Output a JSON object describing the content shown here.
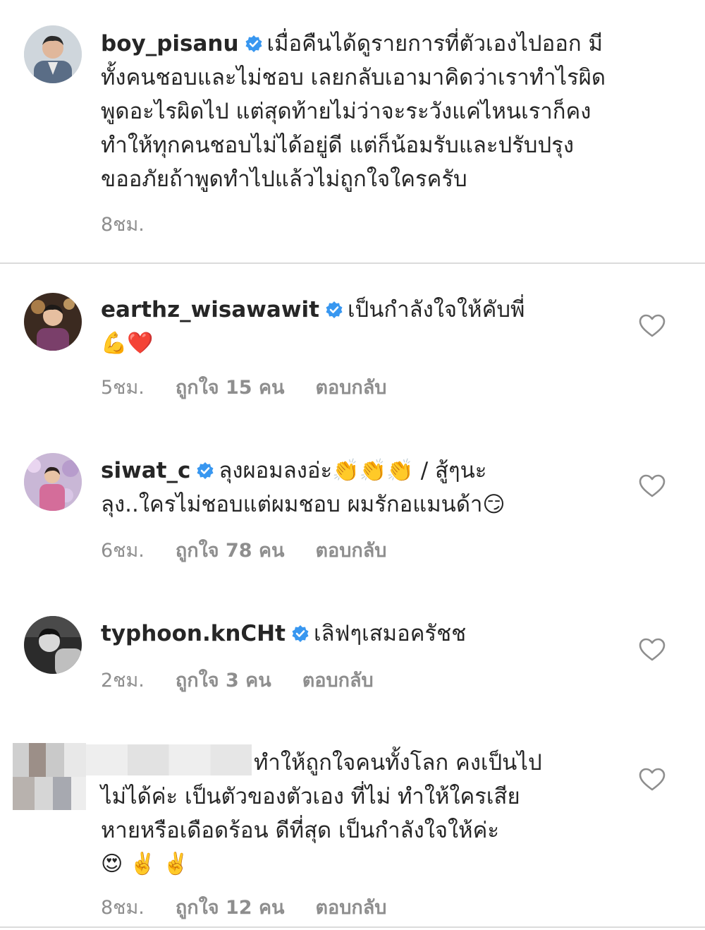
{
  "post": {
    "username": "boy_pisanu",
    "text_lines": [
      "เมื่อคืนได้ดูรายการที่ตัวเองไปออก มี",
      "ทั้งคนชอบและไม่ชอบ เลยกลับเอามาคิดว่าเราทำไรผิด",
      "พูดอะไรผิดไป แต่สุดท้ายไม่ว่าจะระวังแค่ไหนเราก็คง",
      "ทำให้ทุกคนชอบไม่ได้อยู่ดี แต่ก็น้อมรับและปรับปรุง",
      "ขออภัยถ้าพูดทำไปแล้วไม่ถูกใจใครครับ"
    ],
    "time": "8ชม."
  },
  "comments": [
    {
      "username": "earthz_wisawawit",
      "line1": "เป็นกำลังใจให้คับพี่",
      "line2": "💪❤️",
      "time": "5ชม.",
      "likes": "ถูกใจ 15 คน",
      "reply": "ตอบกลับ"
    },
    {
      "username": "siwat_c",
      "line1": "ลุงผอมลงอ่ะ👏👏👏 / สู้ๆนะ",
      "line2": "ลุง..ใครไม่ชอบแต่ผมชอบ ผมรักอแมนด้า😏",
      "time": "6ชม.",
      "likes": "ถูกใจ 78 คน",
      "reply": "ตอบกลับ"
    },
    {
      "username": "typhoon.knCHt",
      "line1": "เลิฟๆเสมอครัชช",
      "time": "2ชม.",
      "likes": "ถูกใจ 3 คน",
      "reply": "ตอบกลับ"
    },
    {
      "line1": "ทำให้ถูกใจคนทั้งโลก คงเป็นไป",
      "line2": "ไม่ได้ค่ะ เป็นตัวของตัวเอง ที่ไม่ ทำให้ใครเสีย",
      "line3": "หายหรือเดือดร้อน ดีที่สุด เป็นกำลังใจให้ค่ะ",
      "line4": "😍 ✌️ ✌️",
      "time": "8ชม.",
      "likes": "ถูกใจ 12 คน",
      "reply": "ตอบกลับ"
    }
  ],
  "icons": {
    "verified": "verified-badge-icon",
    "heart": "heart-outline-icon"
  },
  "colors": {
    "verified_blue": "#3897f0",
    "meta_gray": "#8e8e8e",
    "text": "#262626",
    "divider": "#dbdbdb"
  }
}
